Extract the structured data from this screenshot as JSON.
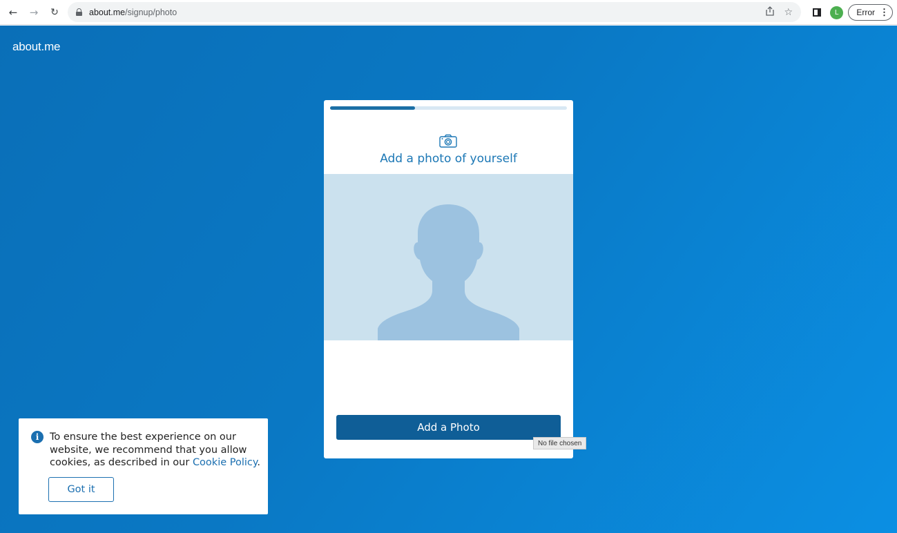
{
  "browser": {
    "url_host": "about.me",
    "url_path": "/signup/photo",
    "profile_initial": "L",
    "status_label": "Error"
  },
  "page": {
    "brand": "about.me",
    "signup_progress": 0.36,
    "title": "Add a photo of yourself",
    "add_photo_label": "Add a Photo",
    "file_tooltip": "No file chosen"
  },
  "cookie_banner": {
    "message": "To ensure the best experience on our website, we recommend that you allow cookies, as described in our",
    "link_text": "Cookie Policy",
    "button_label": "Got it"
  },
  "colors": {
    "page_gradient_start": "#0a6fb8",
    "page_gradient_end": "#0b8fe3",
    "accent": "#1b77b5",
    "button": "#0f5e97",
    "photo_placeholder_bg": "#cbe1ee",
    "silhouette": "#9cc2e0"
  }
}
